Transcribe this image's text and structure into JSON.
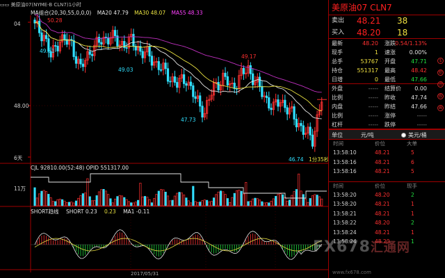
{
  "header": {
    "caret": "▭▭",
    "title": "美原油07(NYME-B CLN7)1小时"
  },
  "main_legend": {
    "ma_group": "MA组合(20,30,55,0,0,0)",
    "ma20": "MA20 47.79",
    "ma30": "MA30 48.07",
    "ma55": "MA55 48.33"
  },
  "price_axis": {
    "top": "04",
    "mid": "48.00",
    "bottom": "6天"
  },
  "chart_annotations": {
    "hi1": "50.28",
    "lo1": "49.51",
    "lo2": "49.03",
    "hi2": "49.17",
    "lo3": "47.73",
    "lo4": "46.74",
    "countdown": "1分35秒"
  },
  "ind1": {
    "legend": "CJL  92810.00(52:48)   OPID  551317.00",
    "axis": "11万"
  },
  "ind2": {
    "name": "SHORT趋线",
    "short1": "SHORT  0.23",
    "short2": "0.23",
    "ma1": "MA1  -0.11"
  },
  "date": "2017/05/31",
  "panel": {
    "title": "美原油07  CLN7",
    "sell": {
      "label": "卖出",
      "price": "48.21",
      "qty": "38"
    },
    "buy": {
      "label": "买入",
      "price": "48.20",
      "qty": "18"
    },
    "rows": [
      {
        "l1": "最新",
        "v1": "48.20",
        "c1": "#ff3030",
        "l2": "涨跌",
        "v2": "0.54/1.13%",
        "c2": "#ff3030"
      },
      {
        "l1": "现手",
        "v1": "1",
        "c1": "#f0e040",
        "l2": "速涨",
        "v2": "0.00%",
        "c2": "#e0e0e0"
      },
      {
        "l1": "总手",
        "v1": "53767",
        "c1": "#f0e040",
        "l2": "开盘",
        "v2": "47.71",
        "c2": "#20e040"
      },
      {
        "l1": "持仓",
        "v1": "551317",
        "c1": "#f0e040",
        "l2": "最高",
        "v2": "48.42",
        "c2": "#ff3030"
      },
      {
        "l1": "日增",
        "v1": "0",
        "c1": "#f0e040",
        "l2": "最低",
        "v2": "47.66",
        "c2": "#20e040"
      },
      {
        "l1": "外盘",
        "v1": "-----",
        "c1": "#888888",
        "l2": "结算价",
        "v2": "0.00",
        "c2": "#e0e0e0"
      },
      {
        "l1": "比例",
        "v1": "-----",
        "c1": "#888888",
        "l2": "昨收",
        "v2": "47.74",
        "c2": "#e0e0e0"
      },
      {
        "l1": "内盘",
        "v1": "-----",
        "c1": "#888888",
        "l2": "昨结",
        "v2": "47.66",
        "c2": "#e0e0e0"
      },
      {
        "l1": "比例",
        "v1": "-----",
        "c1": "#888888",
        "l2": "涨停",
        "v2": "-----",
        "c2": "#888888"
      },
      {
        "l1": "杠杆",
        "v1": "-----",
        "c1": "#888888",
        "l2": "跌停",
        "v2": "-----",
        "c2": "#888888"
      }
    ],
    "unit": {
      "label": "单位",
      "u1": "元/吨",
      "u2": "美元/桶"
    },
    "tick_head": {
      "time": "时间",
      "price": "价位",
      "qty1": "大单",
      "qty2": "现手"
    },
    "ticks_big": [
      {
        "time": "13:58:10",
        "price": "48.21",
        "qty": "5",
        "color": "red"
      },
      {
        "time": "13:58:16",
        "price": "48.21",
        "qty": "6",
        "color": "red"
      },
      {
        "time": "13:58:16",
        "price": "48.21",
        "qty": "5",
        "color": "red"
      }
    ],
    "ticks": [
      {
        "time": "13:58:20",
        "price": "48.20",
        "qty": "2",
        "color": "green"
      },
      {
        "time": "13:58:20",
        "price": "48.21",
        "qty": "1",
        "color": "red"
      },
      {
        "time": "13:58:21",
        "price": "48.21",
        "qty": "1",
        "color": "red"
      },
      {
        "time": "13:58:22",
        "price": "48.20",
        "qty": "2",
        "color": "green"
      },
      {
        "time": "13:58:24",
        "price": "48.21",
        "qty": "1",
        "color": "red"
      },
      {
        "time": "13:58:24",
        "price": "48.20",
        "qty": "1",
        "color": "green"
      }
    ]
  },
  "side_icons": [
    "$",
    "新",
    "资",
    "板",
    "画"
  ],
  "watermark": {
    "brand": "FX678",
    "sub": "汇通网",
    "url": "www.fx678.com"
  }
}
